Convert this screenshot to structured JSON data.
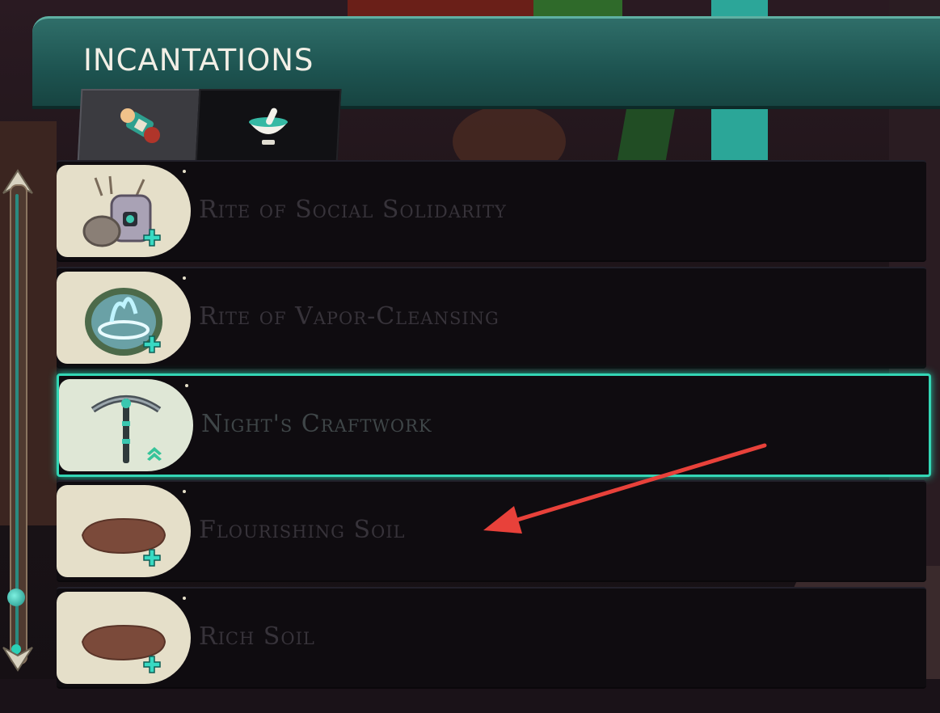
{
  "header": {
    "title": "INCANTATIONS"
  },
  "tabs": [
    {
      "icon": "scroll-icon",
      "active": true
    },
    {
      "icon": "mortar-pestle-icon",
      "active": false
    }
  ],
  "items": [
    {
      "name": "Rite of Social Solidarity",
      "icon": "tree-stump-house-icon",
      "status": "plus-icon",
      "selected": false
    },
    {
      "name": "Rite of Vapor-Cleansing",
      "icon": "vapor-pool-icon",
      "status": "plus-icon",
      "selected": false
    },
    {
      "name": "Night's Craftwork",
      "icon": "pickaxe-icon",
      "status": "upgrade-chevron-icon",
      "selected": true
    },
    {
      "name": "Flourishing Soil",
      "icon": "soil-patch-icon",
      "status": "plus-icon",
      "selected": false
    },
    {
      "name": "Rich Soil",
      "icon": "soil-patch-icon",
      "status": "plus-icon",
      "selected": false
    }
  ],
  "colors": {
    "accent": "#33d6b5",
    "header": "#1d5350",
    "annotation_arrow": "#e8413a"
  }
}
